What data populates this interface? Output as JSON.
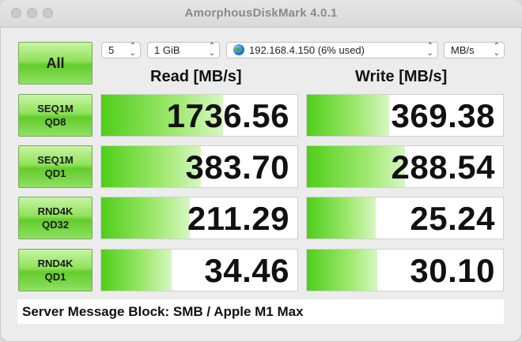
{
  "window": {
    "title": "AmorphousDiskMark 4.0.1"
  },
  "controls": {
    "count": "5",
    "size": "1 GiB",
    "target": "192.168.4.150 (6% used)",
    "unit": "MB/s"
  },
  "buttons": {
    "all": "All"
  },
  "headers": {
    "read": "Read [MB/s]",
    "write": "Write [MB/s]"
  },
  "tests": [
    {
      "line1": "SEQ1M",
      "line2": "QD8",
      "read": "1736.56",
      "write": "369.38",
      "read_fill": 0.62,
      "write_fill": 0.42
    },
    {
      "line1": "SEQ1M",
      "line2": "QD1",
      "read": "383.70",
      "write": "288.54",
      "read_fill": 0.51,
      "write_fill": 0.5
    },
    {
      "line1": "RND4K",
      "line2": "QD32",
      "read": "211.29",
      "write": "25.24",
      "read_fill": 0.45,
      "write_fill": 0.35
    },
    {
      "line1": "RND4K",
      "line2": "QD1",
      "read": "34.46",
      "write": "30.10",
      "read_fill": 0.36,
      "write_fill": 0.36
    }
  ],
  "comment": "Server Message Block: SMB / Apple M1 Max"
}
